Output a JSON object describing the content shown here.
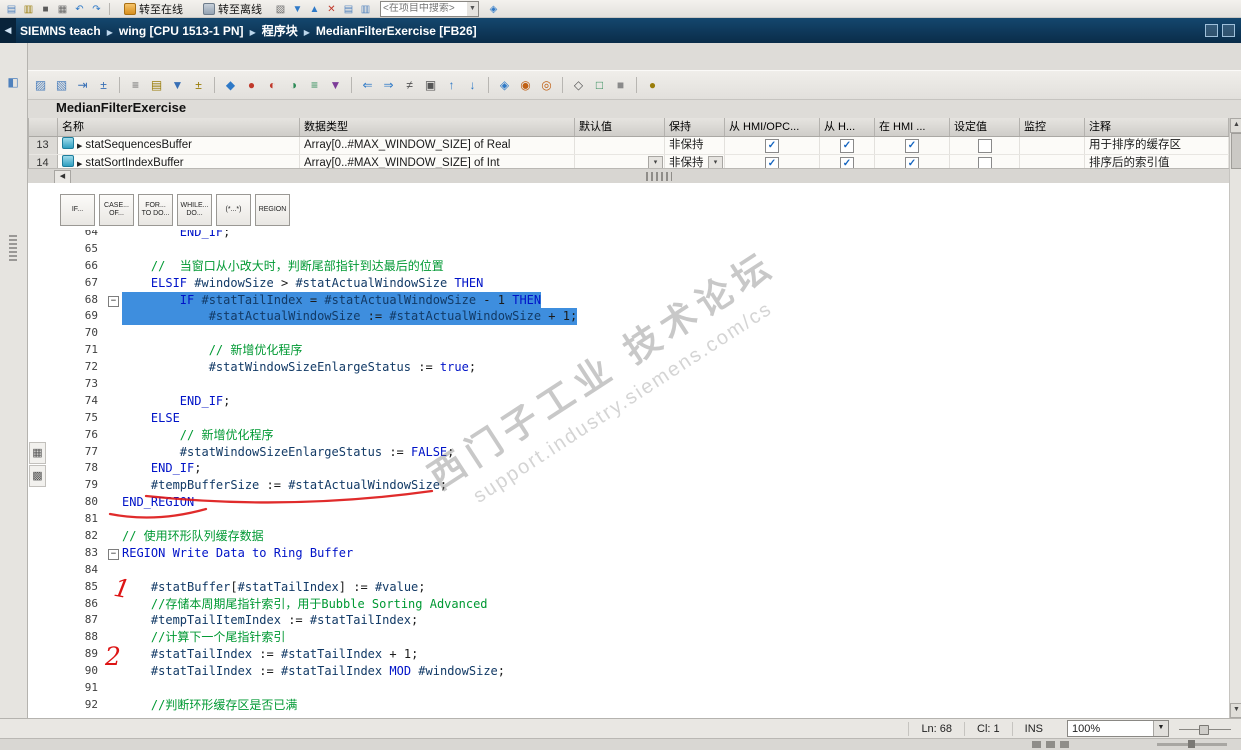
{
  "colors": {
    "accent_blue": "#2e79c7",
    "selection": "#3e8ede",
    "keyword": "#0013c8",
    "comment": "#009933",
    "variable": "#123a66",
    "annotation_red": "#dd1414",
    "breadcrumb_bg": "#0c3354"
  },
  "top_toolbar": {
    "icons_left": [
      {
        "n": "new-project-icon",
        "g": "▤",
        "c": "#4f81bd"
      },
      {
        "n": "open-project-icon",
        "g": "▥",
        "c": "#9a7d0a"
      },
      {
        "n": "save-project-icon",
        "g": "■",
        "c": "#5a5a5a"
      },
      {
        "n": "print-icon",
        "g": "▦",
        "c": "#6a6a6a"
      },
      {
        "n": "undo-icon",
        "g": "↶",
        "c": "#2e79c7"
      },
      {
        "n": "redo-icon",
        "g": "↷",
        "c": "#2e79c7"
      }
    ],
    "go_online": "转至在线",
    "go_offline": "转至离线",
    "icons_mid": [
      {
        "n": "compile-icon",
        "g": "▧",
        "c": "#6a6a6a"
      },
      {
        "n": "download-icon",
        "g": "▼",
        "c": "#2e79c7"
      },
      {
        "n": "upload-icon",
        "g": "▲",
        "c": "#2e79c7"
      },
      {
        "n": "cancel-icon",
        "g": "✕",
        "c": "#c0392b"
      },
      {
        "n": "split-horizontal-icon",
        "g": "▤",
        "c": "#4f81bd"
      },
      {
        "n": "split-vertical-icon",
        "g": "▥",
        "c": "#4f81bd"
      }
    ],
    "search_placeholder": "<在项目中搜索>",
    "icons_right": [
      {
        "n": "link-icon",
        "g": "◈",
        "c": "#2e79c7"
      }
    ]
  },
  "breadcrumb": {
    "items": [
      "SIEMNS teach",
      "wing [CPU 1513-1 PN]",
      "程序块",
      "MedianFilterExercise [FB26]"
    ]
  },
  "editor_toolbar": {
    "icons": [
      {
        "g": "▨",
        "c": "#4f81bd"
      },
      {
        "g": "▧",
        "c": "#4f81bd"
      },
      {
        "g": "⇥",
        "c": "#376fb5"
      },
      {
        "g": "±",
        "c": "#376fb5"
      },
      "|",
      {
        "g": "≡",
        "c": "#6a6a6a"
      },
      {
        "g": "▤",
        "c": "#9a7d0a"
      },
      {
        "g": "▼",
        "c": "#376fb5"
      },
      {
        "g": "±",
        "c": "#9a7d0a"
      },
      "|",
      {
        "g": "◆",
        "c": "#2e79c7"
      },
      {
        "g": "●",
        "c": "#c0392b"
      },
      {
        "g": "◐",
        "c": "#c0392b"
      },
      {
        "g": "◑",
        "c": "#2e8b57"
      },
      {
        "g": "≡",
        "c": "#2e8b57"
      },
      {
        "g": "▼",
        "c": "#7d3c98"
      },
      "|",
      {
        "g": "⇐",
        "c": "#2e79c7"
      },
      {
        "g": "⇒",
        "c": "#2e79c7"
      },
      {
        "g": "≠",
        "c": "#555555"
      },
      {
        "g": "▣",
        "c": "#555555"
      },
      {
        "g": "↑",
        "c": "#2e79c7"
      },
      {
        "g": "↓",
        "c": "#2e79c7"
      },
      "|",
      {
        "g": "◈",
        "c": "#2e79c7"
      },
      {
        "g": "◉",
        "c": "#c06014"
      },
      {
        "g": "◎",
        "c": "#c06014"
      },
      "|",
      {
        "g": "◇",
        "c": "#555555"
      },
      {
        "g": "□",
        "c": "#2e8b57"
      },
      {
        "g": "■",
        "c": "#8a8a8a"
      },
      "|",
      {
        "g": "●",
        "c": "#9a7d0a"
      }
    ]
  },
  "editor": {
    "title": "MedianFilterExercise"
  },
  "table": {
    "headers": [
      "",
      "名称",
      "数据类型",
      "默认值",
      "保持",
      "从 HMI/OPC...",
      "从 H...",
      "在 HMI ...",
      "设定值",
      "监控",
      "注释"
    ],
    "rows": [
      {
        "num": "13",
        "name": "statSequencesBuffer",
        "type": "Array[0..#MAX_WINDOW_SIZE] of Real",
        "default": "",
        "retain": "非保持",
        "checks": [
          true,
          true,
          true,
          false
        ],
        "comment": "用于排序的缓存区",
        "clipped": false,
        "combo": false
      },
      {
        "num": "14",
        "name": "statSortIndexBuffer",
        "type": "Array[0..#MAX_WINDOW_SIZE] of Int",
        "default": "",
        "retain": "非保持",
        "checks": [
          true,
          true,
          true,
          false
        ],
        "comment": "排序后的索引值",
        "clipped": true,
        "combo": true
      }
    ]
  },
  "snippets": [
    [
      "IF...",
      ""
    ],
    [
      "CASE...",
      "OF..."
    ],
    [
      "FOR...",
      "TO DO..."
    ],
    [
      "WHILE...",
      "DO..."
    ],
    [
      "(*...*)",
      ""
    ],
    [
      "REGION",
      ""
    ]
  ],
  "code": {
    "keywords": [
      "IF",
      "THEN",
      "ELSIF",
      "ELSE",
      "END_IF",
      "REGION",
      "END_REGION",
      "MOD",
      "TRUE",
      "FALSE"
    ],
    "lines": [
      {
        "n": 64,
        "t": "        END_IF;"
      },
      {
        "n": 65,
        "t": ""
      },
      {
        "n": 66,
        "t": "    //  当窗口从小改大时，判断尾部指针到达最后的位置"
      },
      {
        "n": 67,
        "t": "    ELSIF #windowSize > #statActualWindowSize THEN"
      },
      {
        "n": 68,
        "t": "        IF #statTailIndex = #statActualWindowSize - 1 THEN",
        "sel": true,
        "fold": true
      },
      {
        "n": 69,
        "t": "            #statActualWindowSize := #statActualWindowSize + 1;",
        "sel": true
      },
      {
        "n": 70,
        "t": ""
      },
      {
        "n": 71,
        "t": "            // 新增优化程序"
      },
      {
        "n": 72,
        "t": "            #statWindowSizeEnlargeStatus := true;"
      },
      {
        "n": 73,
        "t": ""
      },
      {
        "n": 74,
        "t": "        END_IF;"
      },
      {
        "n": 75,
        "t": "    ELSE"
      },
      {
        "n": 76,
        "t": "        // 新增优化程序"
      },
      {
        "n": 77,
        "t": "        #statWindowSizeEnlargeStatus := FALSE;"
      },
      {
        "n": 78,
        "t": "    END_IF;"
      },
      {
        "n": 79,
        "t": "    #tempBufferSize := #statActualWindowSize;"
      },
      {
        "n": 80,
        "t": "END_REGION"
      },
      {
        "n": 81,
        "t": ""
      },
      {
        "n": 82,
        "t": "// 使用环形队列缓存数据"
      },
      {
        "n": 83,
        "t": "REGION Write Data to Ring Buffer",
        "fold": true
      },
      {
        "n": 84,
        "t": ""
      },
      {
        "n": 85,
        "t": "    #statBuffer[#statTailIndex] := #value;"
      },
      {
        "n": 86,
        "t": "    //存储本周期尾指针索引，用于Bubble Sorting Advanced"
      },
      {
        "n": 87,
        "t": "    #tempTailItemIndex := #statTailIndex;"
      },
      {
        "n": 88,
        "t": "    //计算下一个尾指针索引"
      },
      {
        "n": 89,
        "t": "    #statTailIndex := #statTailIndex + 1;"
      },
      {
        "n": 90,
        "t": "    #statTailIndex := #statTailIndex MOD #windowSize;"
      },
      {
        "n": 91,
        "t": ""
      },
      {
        "n": 92,
        "t": "    //判断环形缓存区是否已满"
      }
    ]
  },
  "watermark": {
    "line1": "西门子工业 技术论坛",
    "line2": "support.industry.siemens.com/cs"
  },
  "annotations": {
    "mark1": "1",
    "mark2": "2"
  },
  "left_margin_icons": [
    "▦",
    "▩"
  ],
  "status_bar": {
    "line": "Ln: 68",
    "col": "Cl: 1",
    "mode": "INS",
    "zoom": "100%"
  }
}
